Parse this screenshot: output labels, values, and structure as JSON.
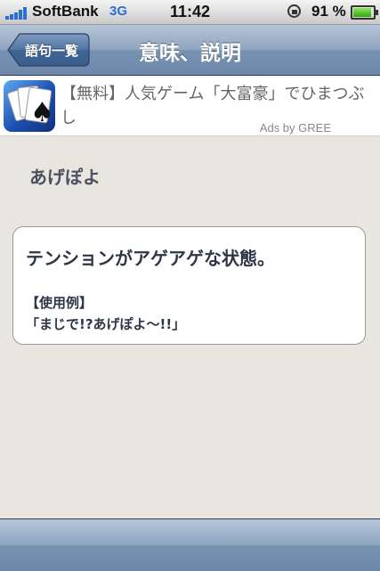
{
  "status_bar": {
    "carrier": "SoftBank",
    "network": "3G",
    "time": "11:42",
    "battery_percent": "91 %",
    "battery_level": 0.91,
    "icons": [
      "signal-icon",
      "orientation-lock-icon",
      "battery-icon"
    ]
  },
  "nav": {
    "back_label": "語句一覧",
    "title": "意味、説明"
  },
  "ad": {
    "text": "【無料】人気ゲーム「大富豪」でひまつぶし",
    "attribution": "Ads by GREE",
    "icon": "spade-cards-icon"
  },
  "entry": {
    "word": "あげぽよ",
    "meaning": "テンションがアゲアゲな状態。",
    "example_label": "【使用例】",
    "example": "「まじで!?あげぽよ〜!!」"
  },
  "colors": {
    "nav_bar": "#7792b2",
    "background": "#e9e6df",
    "text": "#2e3547",
    "signal": "#2b6fd6"
  }
}
